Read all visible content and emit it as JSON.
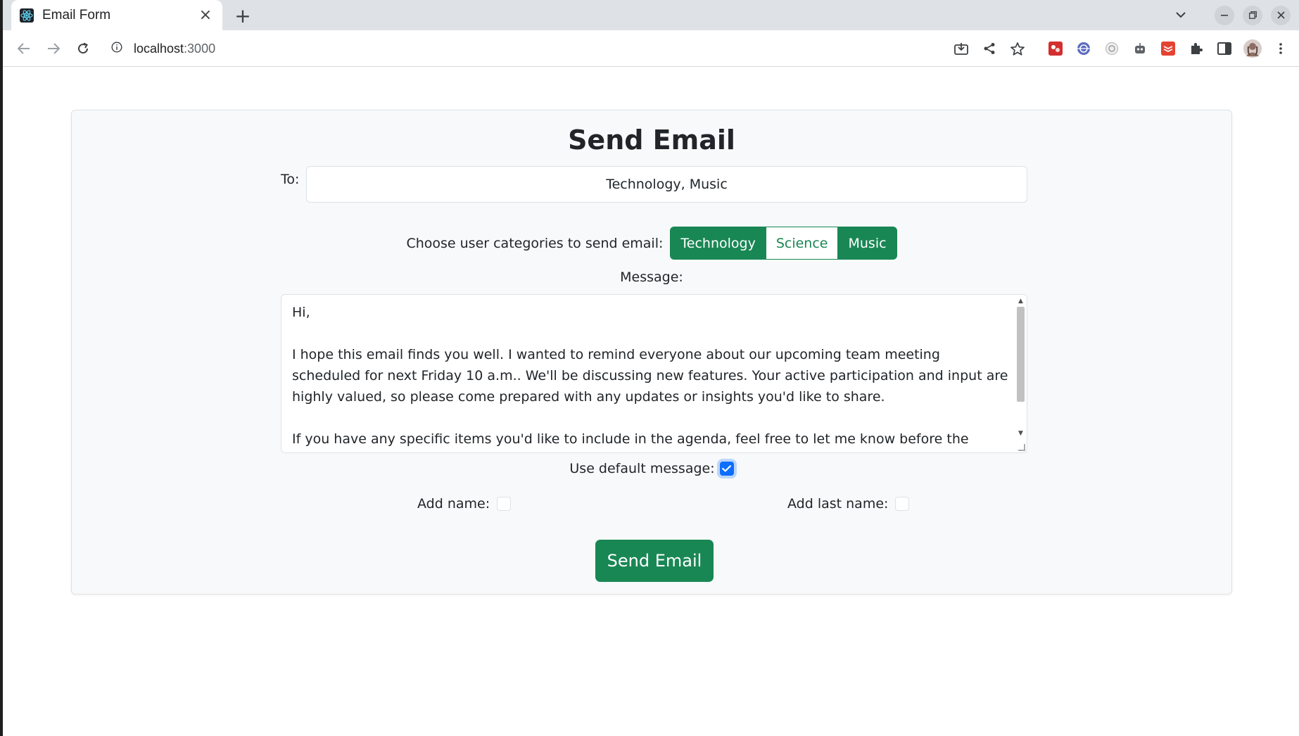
{
  "browser": {
    "tab_title": "Email Form",
    "tab_close": "×",
    "new_tab": "+",
    "url_host": "localhost",
    "url_port": ":3000"
  },
  "form": {
    "title": "Send Email",
    "to_label": "To:",
    "to_value": "Technology, Music",
    "categories_label": "Choose user categories to send email:",
    "categories": [
      {
        "label": "Technology",
        "selected": true
      },
      {
        "label": "Science",
        "selected": false
      },
      {
        "label": "Music",
        "selected": true
      }
    ],
    "message_label": "Message:",
    "message_text": "Hi,\n\nI hope this email finds you well. I wanted to remind everyone about our upcoming team meeting scheduled for next Friday 10 a.m.. We'll be discussing new features. Your active participation and input are highly valued, so please come prepared with any updates or insights you'd like to share.\n\nIf you have any specific items you'd like to include in the agenda, feel free to let me know before the meeting.",
    "use_default_label": "Use default message:",
    "use_default_checked": true,
    "add_name_label": "Add name:",
    "add_name_checked": false,
    "add_last_name_label": "Add last name:",
    "add_last_name_checked": false,
    "send_label": "Send Email"
  },
  "colors": {
    "accent_green": "#198754",
    "checkbox_blue": "#0d6efd",
    "card_bg": "#f8f9fa"
  }
}
